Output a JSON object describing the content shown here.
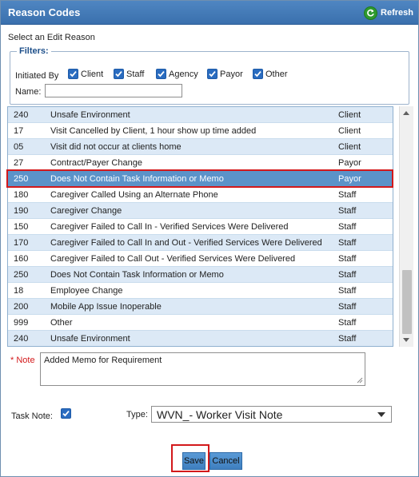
{
  "dialog": {
    "title": "Reason Codes",
    "refresh_label": "Refresh",
    "subtitle": "Select an Edit Reason"
  },
  "filters": {
    "legend": "Filters:",
    "initiated_by_label": "Initiated By",
    "options": [
      {
        "label": "Client",
        "checked": true
      },
      {
        "label": "Staff",
        "checked": true
      },
      {
        "label": "Agency",
        "checked": true
      },
      {
        "label": "Payor",
        "checked": true
      },
      {
        "label": "Other",
        "checked": true
      }
    ],
    "name_label": "Name:",
    "name_value": ""
  },
  "reasons": [
    {
      "code": "240",
      "description": "Unsafe Environment",
      "initiated_by": "Client"
    },
    {
      "code": "17",
      "description": "Visit Cancelled by Client, 1 hour show up time added",
      "initiated_by": "Client"
    },
    {
      "code": "05",
      "description": "Visit did not occur at clients home",
      "initiated_by": "Client"
    },
    {
      "code": "27",
      "description": "Contract/Payer Change",
      "initiated_by": "Payor"
    },
    {
      "code": "250",
      "description": "Does Not Contain Task Information or Memo",
      "initiated_by": "Payor"
    },
    {
      "code": "180",
      "description": "Caregiver Called Using an Alternate Phone",
      "initiated_by": "Staff"
    },
    {
      "code": "190",
      "description": "Caregiver Change",
      "initiated_by": "Staff"
    },
    {
      "code": "150",
      "description": "Caregiver Failed to Call In - Verified Services Were Delivered",
      "initiated_by": "Staff"
    },
    {
      "code": "170",
      "description": "Caregiver Failed to Call In and Out - Verified Services Were Delivered",
      "initiated_by": "Staff"
    },
    {
      "code": "160",
      "description": "Caregiver Failed to Call Out - Verified Services Were Delivered",
      "initiated_by": "Staff"
    },
    {
      "code": "250",
      "description": "Does Not Contain Task Information or Memo",
      "initiated_by": "Staff"
    },
    {
      "code": "18",
      "description": "Employee Change",
      "initiated_by": "Staff"
    },
    {
      "code": "200",
      "description": "Mobile App Issue Inoperable",
      "initiated_by": "Staff"
    },
    {
      "code": "999",
      "description": "Other",
      "initiated_by": "Staff"
    },
    {
      "code": "240",
      "description": "Unsafe Environment",
      "initiated_by": "Staff"
    }
  ],
  "selected_row_index": 4,
  "note": {
    "required_marker": "*",
    "label": "Note",
    "value": "Added Memo for Requirement"
  },
  "task_note": {
    "label": "Task Note:",
    "checked": true
  },
  "type": {
    "label": "Type:",
    "selected": "WVN_- Worker Visit Note"
  },
  "buttons": {
    "save": "Save",
    "cancel": "Cancel"
  },
  "colors": {
    "title_bar": "#3f78b8",
    "selected_row": "#5b93c9",
    "alt_row": "#dce9f6",
    "annotation_red": "#d3191b"
  }
}
